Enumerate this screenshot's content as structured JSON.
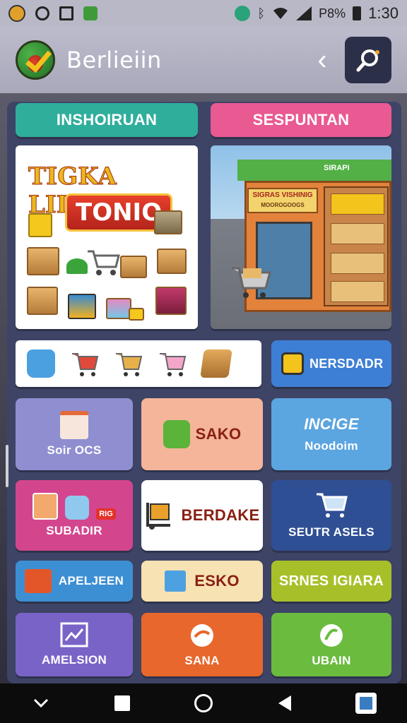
{
  "status_bar": {
    "battery": "P8%",
    "time": "1:30"
  },
  "app_bar": {
    "title": "Berlieiin"
  },
  "tabs": {
    "left": "INSHOIRUAN",
    "right": "SESPUNTAN"
  },
  "promo": {
    "title_line1": "TIGKA LIDUAL",
    "title_line2": "TONIO"
  },
  "store": {
    "sign": "SIGRAS VISHINIG",
    "sign_sub": "MOOROGOOGS",
    "roof_label": "SIRAPI"
  },
  "tiles": {
    "nersdadr": "NERSDADR",
    "soroes": "Soir OCS",
    "sako": "SAKO",
    "invcice_title": "INCIGE",
    "invcice_sub": "Noodoim",
    "subadir": "SUBADIR",
    "subadir_badge": "RIG",
    "berdake": "BERDAKE",
    "seutr": "SEUTR ASELS",
    "apeljeen": "APELJEEN",
    "esko": "ESKO",
    "srnes": "SRNES IGIARA",
    "amelsion": "AMELSION",
    "sana": "SANA",
    "ubain": "UBAIN"
  },
  "colors": {
    "accent_teal": "#2fae9c",
    "accent_pink": "#e95992",
    "panel": "#3e4466"
  }
}
